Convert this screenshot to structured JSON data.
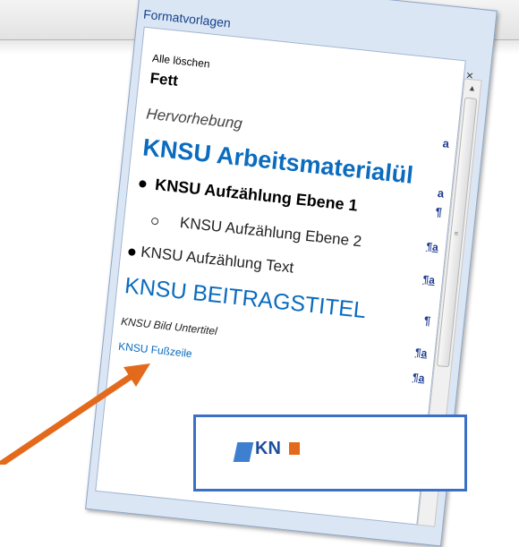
{
  "panel": {
    "caption": "Formatvorlagen",
    "clear_all": "Alle löschen",
    "dropdown_glyph": "▾",
    "close_glyph": "×",
    "scroll_up_glyph": "▲",
    "grip_glyph": "≡"
  },
  "styles": [
    {
      "label": "Fett",
      "mark": ""
    },
    {
      "label": "Hervorhebung",
      "mark": "a"
    },
    {
      "label": "KNSU Arbeitsmaterialül",
      "mark": "a"
    },
    {
      "label": "KNSU Aufzählung Ebene 1",
      "mark": "¶"
    },
    {
      "label": "KNSU Aufzählung Ebene 2",
      "mark": "¶a"
    },
    {
      "label": "KNSU Aufzählung Text",
      "mark": "¶a"
    },
    {
      "label": "KNSU BEITRAGSTITEL",
      "mark": "¶"
    },
    {
      "label": "KNSU Bild Untertitel",
      "mark": "¶a"
    },
    {
      "label": "KNSU Fußzeile",
      "mark": "¶a"
    }
  ],
  "overlay": {
    "logo_text": "KN"
  },
  "colors": {
    "accent_blue": "#0a6bbf",
    "arrow_orange": "#e36a1b",
    "frame_blue": "#3a6fc6"
  }
}
